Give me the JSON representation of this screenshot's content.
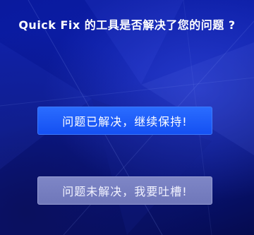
{
  "dialog": {
    "question": "Quick Fix 的工具是否解决了您的问题 ?"
  },
  "buttons": {
    "solved_label": "问题已解决，继续保持!",
    "unsolved_label": "问题未解决，我要吐槽!"
  },
  "colors": {
    "background": "#0b1a8c",
    "solved_button": "#1f5cff",
    "unsolved_button": "#7880c0",
    "text": "#ffffff"
  }
}
